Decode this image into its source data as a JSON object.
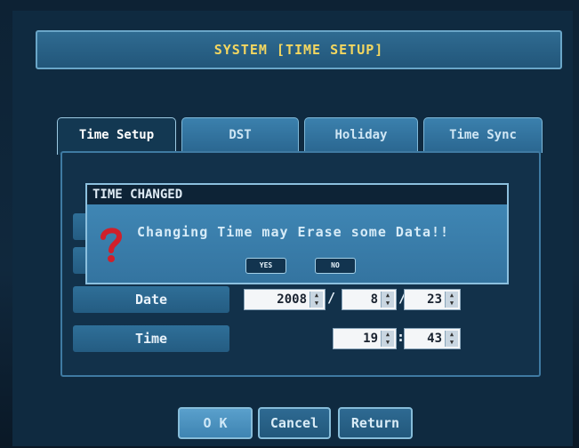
{
  "title": "SYSTEM [TIME SETUP]",
  "tabs": [
    {
      "label": "Time Setup",
      "active": true
    },
    {
      "label": "DST",
      "active": false
    },
    {
      "label": "Holiday",
      "active": false
    },
    {
      "label": "Time Sync",
      "active": false
    }
  ],
  "fields": {
    "date": {
      "label": "Date",
      "year": "2008",
      "month": "8",
      "day": "23",
      "separator": "/"
    },
    "time": {
      "label": "Time",
      "hour": "19",
      "minute": "43",
      "separator": ":"
    }
  },
  "dialog": {
    "title": "TIME CHANGED",
    "message": "Changing Time may Erase some Data!!",
    "icon": "question-mark-icon",
    "yes_label": "YES",
    "no_label": "NO"
  },
  "buttons": {
    "ok_label": "O K",
    "cancel_label": "Cancel",
    "return_label": "Return"
  },
  "colors": {
    "title_text": "#f4d760",
    "panel_bg": "#12314a",
    "accent": "#3c7ba5",
    "question_mark": "#d0202a"
  }
}
